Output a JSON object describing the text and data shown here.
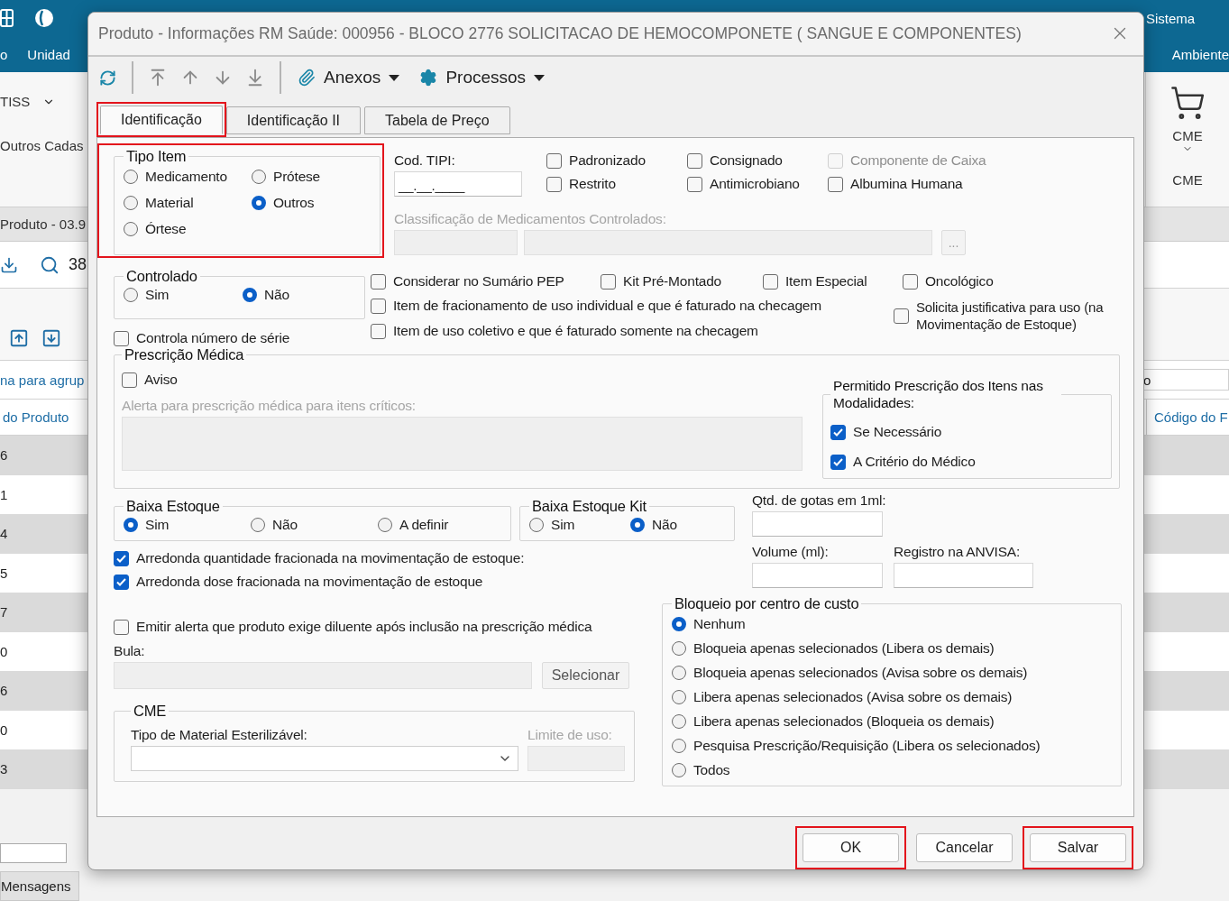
{
  "background": {
    "header_left": [
      "o",
      "Unidad"
    ],
    "header_right": [
      "Sistema",
      "Ambiente"
    ],
    "ribbon_left": [
      "TISS",
      "Outros Cadas"
    ],
    "ribbon_right": {
      "button": "CME",
      "group": "CME"
    },
    "document_tab": "Produto - 03.9",
    "search_value": "38",
    "group_hint": "na para agrup",
    "left_column": "do Produto",
    "right_field": "o",
    "right_column": "Código do F",
    "left_rows": [
      "6",
      "1",
      "4",
      "5",
      "7",
      "0",
      "6",
      "0",
      "3"
    ],
    "bottom_tab": "Mensagens"
  },
  "dialog": {
    "title": "Produto - Informações RM Saúde: 000956 - BLOCO 2776  SOLICITACAO DE HEMOCOMPONETE ( SANGUE E COMPONENTES)",
    "toolbar_menus": [
      "Anexos",
      "Processos"
    ],
    "tabs": [
      {
        "label": "Identificação",
        "selected": true,
        "highlighted": true
      },
      {
        "label": "Identificação II",
        "selected": false,
        "highlighted": false
      },
      {
        "label": "Tabela de Preço",
        "selected": false,
        "highlighted": false
      }
    ],
    "tipo_item": {
      "title": "Tipo Item",
      "highlighted": true,
      "options": [
        {
          "label": "Medicamento",
          "selected": false
        },
        {
          "label": "Prótese",
          "selected": false
        },
        {
          "label": "Material",
          "selected": false
        },
        {
          "label": "Outros",
          "selected": true
        },
        {
          "label": "Órtese",
          "selected": false
        }
      ]
    },
    "cod_tipi": {
      "label": "Cod. TIPI:",
      "value": "__.__.____"
    },
    "flags": [
      {
        "label": "Padronizado",
        "checked": false,
        "disabled": false
      },
      {
        "label": "Consignado",
        "checked": false,
        "disabled": false
      },
      {
        "label": "Componente de Caixa",
        "checked": false,
        "disabled": true
      },
      {
        "label": "Restrito",
        "checked": false,
        "disabled": false
      },
      {
        "label": "Antimicrobiano",
        "checked": false,
        "disabled": false
      },
      {
        "label": "Albumina Humana",
        "checked": false,
        "disabled": false
      }
    ],
    "classificacao": {
      "label": "Classificação de Medicamentos Controlados:",
      "button": "..."
    },
    "controlado": {
      "title": "Controlado",
      "options": [
        {
          "label": "Sim",
          "selected": false
        },
        {
          "label": "Não",
          "selected": true
        }
      ]
    },
    "controla_serie": {
      "label": "Controla número de série",
      "checked": false
    },
    "flags_row": [
      {
        "label": "Considerar no Sumário PEP",
        "checked": false
      },
      {
        "label": "Kit Pré-Montado",
        "checked": false
      },
      {
        "label": "Item Especial",
        "checked": false
      },
      {
        "label": "Oncológico",
        "checked": false
      }
    ],
    "flags_lines": [
      {
        "label": "Item de fracionamento de uso individual e que é faturado na checagem",
        "checked": false
      },
      {
        "label": "Item de uso coletivo e que é faturado somente na checagem",
        "checked": false
      }
    ],
    "solicita": {
      "label": "Solicita justificativa para uso (na Movimentação de Estoque)",
      "checked": false
    },
    "prescricao": {
      "title": "Prescrição Médica",
      "aviso": {
        "label": "Aviso",
        "checked": false
      },
      "alerta_label": "Alerta para prescrição médica para itens críticos:",
      "permitido": {
        "title": "Permitido Prescrição dos Itens nas Modalidades:",
        "options": [
          {
            "label": "Se Necessário",
            "checked": true
          },
          {
            "label": "A Critério do Médico",
            "checked": true
          }
        ]
      }
    },
    "baixa_estoque": {
      "title": "Baixa Estoque",
      "options": [
        {
          "label": "Sim",
          "selected": true
        },
        {
          "label": "Não",
          "selected": false
        },
        {
          "label": "A definir",
          "selected": false
        }
      ]
    },
    "baixa_estoque_kit": {
      "title": "Baixa Estoque Kit",
      "options": [
        {
          "label": "Sim",
          "selected": false
        },
        {
          "label": "Não",
          "selected": true
        }
      ]
    },
    "qtd_gotas_label": "Qtd. de gotas em 1ml:",
    "volume_label": "Volume (ml):",
    "registro_label": "Registro na ANVISA:",
    "arredonda": [
      {
        "label": "Arredonda quantidade fracionada na movimentação de estoque:",
        "checked": true
      },
      {
        "label": "Arredonda dose fracionada na movimentação de estoque",
        "checked": true
      }
    ],
    "emitir": {
      "label": "Emitir alerta que produto exige diluente após inclusão na prescrição médica",
      "checked": false
    },
    "bula": {
      "label": "Bula:",
      "button": "Selecionar"
    },
    "cme": {
      "title": "CME",
      "tipo_label": "Tipo de Material Esterilizável:",
      "limite_label": "Limite de uso:"
    },
    "bloqueio": {
      "title": "Bloqueio por centro de custo",
      "options": [
        {
          "label": "Nenhum",
          "selected": true
        },
        {
          "label": "Bloqueia apenas selecionados (Libera os demais)",
          "selected": false
        },
        {
          "label": "Bloqueia apenas selecionados (Avisa sobre os demais)",
          "selected": false
        },
        {
          "label": "Libera apenas selecionados (Avisa sobre os demais)",
          "selected": false
        },
        {
          "label": "Libera apenas selecionados (Bloqueia os demais)",
          "selected": false
        },
        {
          "label": "Pesquisa Prescrição/Requisição (Libera os selecionados)",
          "selected": false
        },
        {
          "label": "Todos",
          "selected": false
        }
      ]
    },
    "buttons": [
      {
        "label": "OK",
        "highlighted": true
      },
      {
        "label": "Cancelar",
        "highlighted": false
      },
      {
        "label": "Salvar",
        "highlighted": true
      }
    ]
  }
}
